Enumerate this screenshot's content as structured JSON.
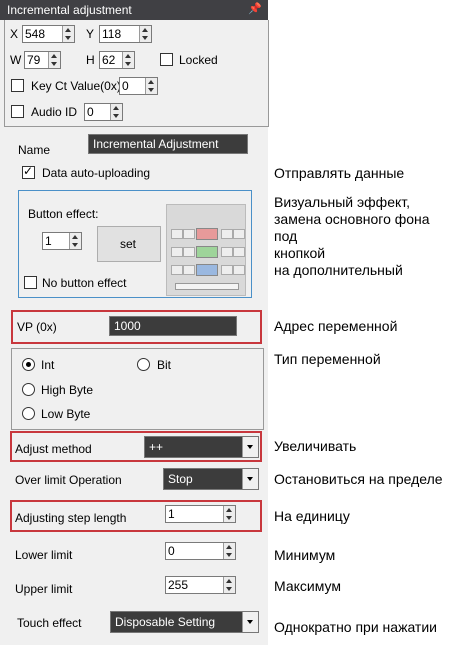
{
  "panel": {
    "title": "Incremental adjustment",
    "pin_icon": "pin-icon"
  },
  "position": {
    "x_label": "X",
    "x_value": "548",
    "y_label": "Y",
    "y_value": "118",
    "w_label": "W",
    "w_value": "79",
    "h_label": "H",
    "h_value": "62",
    "locked_label": "Locked"
  },
  "key_ct": {
    "label": "Key Ct Value(0x)",
    "value": "0"
  },
  "audio": {
    "label": "Audio ID",
    "value": "0"
  },
  "name": {
    "label": "Name",
    "value": "Incremental Adjustment"
  },
  "upload": {
    "label": "Data auto-uploading"
  },
  "button_effect": {
    "label": "Button effect:",
    "value": "1",
    "set_label": "set",
    "no_effect_label": "No button effect"
  },
  "vp": {
    "label": "VP (0x)",
    "value": "1000"
  },
  "var_type": {
    "int_label": "Int",
    "bit_label": "Bit",
    "high_byte_label": "High Byte",
    "low_byte_label": "Low Byte",
    "selected": "Int"
  },
  "adjust_method": {
    "label": "Adjust method",
    "value": "++"
  },
  "over_limit": {
    "label": "Over limit Operation",
    "value": "Stop"
  },
  "step": {
    "label": "Adjusting step length",
    "value": "1"
  },
  "lower": {
    "label": "Lower limit",
    "value": "0"
  },
  "upper": {
    "label": "Upper limit",
    "value": "255"
  },
  "touch": {
    "label": "Touch effect",
    "value": "Disposable Setting"
  },
  "annotations": {
    "upload": "Отправлять данные",
    "button_effect": [
      "Визуальный эффект,",
      "замена основного фона",
      "под",
      "кнопкой",
      "на дополнительный"
    ],
    "vp": "Адрес переменной",
    "var_type": "Тип переменной",
    "adjust": "Увеличивать",
    "over_limit": "Остановиться на пределе",
    "step": "На единицу",
    "lower": "Минимум",
    "upper": "Максимум",
    "touch": "Однократно при нажатии"
  },
  "colors": {
    "highlight_box": "#c8373d",
    "group_border": "#4a90c8",
    "title_bg": "#404044"
  }
}
